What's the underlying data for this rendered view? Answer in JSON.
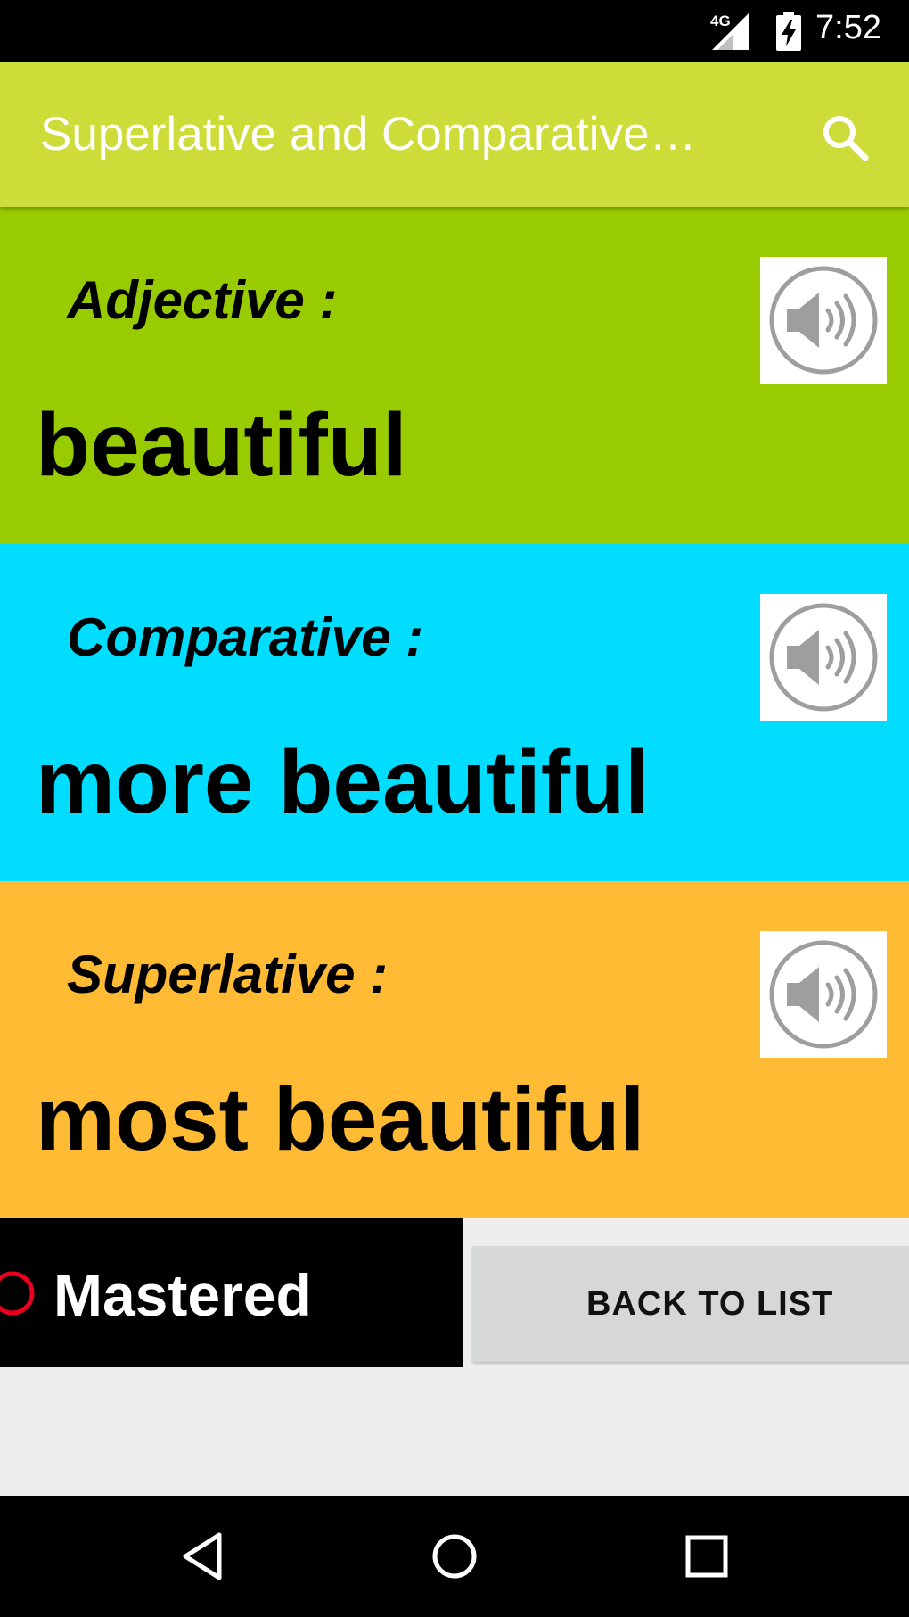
{
  "status_bar": {
    "network": "4G",
    "time": "7:52"
  },
  "app_bar": {
    "title": "Superlative and Comparative…",
    "search_icon": "search-icon",
    "color": "#cddc39"
  },
  "panels": [
    {
      "label": "Adjective :",
      "word": "beautiful",
      "color": "#99cc00",
      "icon": "speaker-icon"
    },
    {
      "label": "Comparative :",
      "word": "more beautiful",
      "color": "#00ddff",
      "icon": "speaker-icon"
    },
    {
      "label": "Superlative :",
      "word": "most beautiful",
      "color": "#ffbb33",
      "icon": "speaker-icon"
    }
  ],
  "mastered": {
    "label": "Mastered",
    "checked": false,
    "radio_color": "#e8001c"
  },
  "back_button": {
    "label": "BACK TO LIST"
  },
  "nav_bar": {
    "icons": [
      "back-triangle-icon",
      "home-circle-icon",
      "recents-square-icon"
    ]
  }
}
